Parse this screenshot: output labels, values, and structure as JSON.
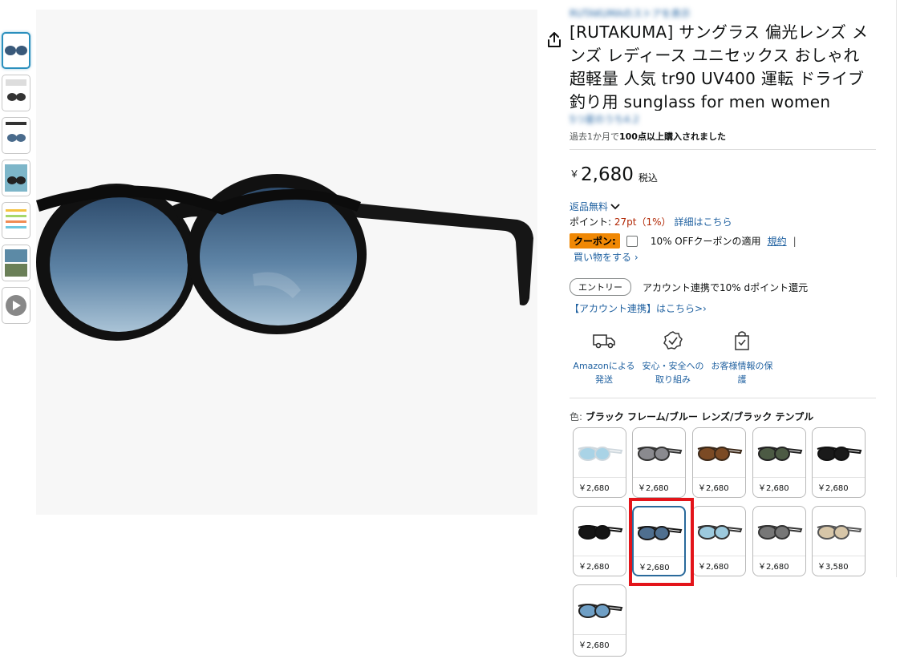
{
  "thumbnails": [
    {
      "name": "thumb-1"
    },
    {
      "name": "thumb-2"
    },
    {
      "name": "thumb-3"
    },
    {
      "name": "thumb-4"
    },
    {
      "name": "thumb-5"
    },
    {
      "name": "thumb-6"
    },
    {
      "name": "thumb-7"
    }
  ],
  "product": {
    "store_link": "RUTAKUMAのストアを表示",
    "title": "[RUTAKUMA] サングラス 偏光レンズ メンズ レディース ユニセックス おしゃれ 超軽量 人気 tr90 UV400 運転 ドライブ 釣り用 sunglass for men women",
    "rating_text": "5つ星のうち4.2",
    "bought_prefix": "過去1か月で",
    "bought_bold": "100点以上購入されました",
    "price_symbol": "￥",
    "price_amount": "2,680",
    "price_tax": "税込",
    "returns_label": "返品無料",
    "points_prefix": "ポイント: ",
    "points_value": "27pt（1%）",
    "points_link": "詳細はこちら",
    "coupon_badge": "クーポン:",
    "coupon_text": "10% OFFクーポンの適用",
    "coupon_terms": "規約",
    "coupon_sep": "|",
    "shop_link": "買い物をする ›",
    "entry_pill": "エントリー",
    "entry_text": "アカウント連携で10% dポイント還元",
    "account_link": "【アカウント連携】はこちら>›"
  },
  "features": [
    {
      "label": "Amazonによる発送",
      "icon": "delivery-truck-icon"
    },
    {
      "label": "安心・安全への取り組み",
      "icon": "safety-badge-icon"
    },
    {
      "label": "お客様情報の保護",
      "icon": "secure-bag-icon"
    }
  ],
  "color": {
    "label_prefix": "色: ",
    "selected_name": "ブラック フレーム/ブルー レンズ/ブラック テンプル"
  },
  "swatches": [
    {
      "price": "￥2,680",
      "lens": "#a9d3e6",
      "frame": "#cfd8de"
    },
    {
      "price": "￥2,680",
      "lens": "#8a8a8f",
      "frame": "#333333"
    },
    {
      "price": "￥2,680",
      "lens": "#7b4a24",
      "frame": "#3b2818"
    },
    {
      "price": "￥2,680",
      "lens": "#4c5a44",
      "frame": "#222222"
    },
    {
      "price": "￥2,680",
      "lens": "#1a1a1a",
      "frame": "#111111"
    },
    {
      "price": "￥2,680",
      "lens": "#161616",
      "frame": "#111111"
    },
    {
      "price": "￥2,680",
      "lens": "#4f6f8f",
      "frame": "#1a1a1a",
      "selected": true
    },
    {
      "price": "￥2,680",
      "lens": "#9cc9dd",
      "frame": "#333333"
    },
    {
      "price": "￥2,680",
      "lens": "#777777",
      "frame": "#333333"
    },
    {
      "price": "￥3,580",
      "lens": "#d7c6a8",
      "frame": "#555555"
    },
    {
      "price": "￥2,680",
      "lens": "#6f9fc5",
      "frame": "#222222"
    }
  ]
}
